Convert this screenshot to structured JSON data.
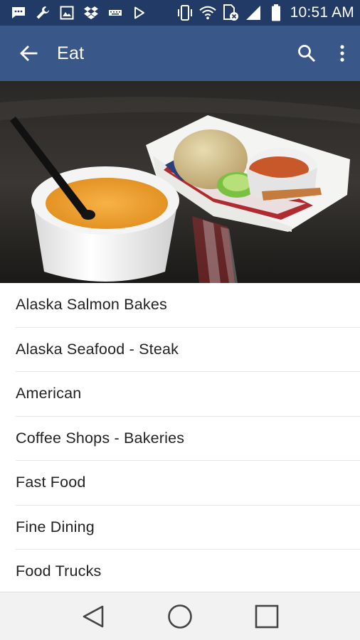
{
  "status_bar": {
    "time": "10:51 AM",
    "icons": [
      "messaging-icon",
      "wrench-icon",
      "image-icon",
      "dropbox-icon",
      "keyboard-icon",
      "play-store-icon",
      "vibrate-icon",
      "wifi-icon",
      "sim-icon",
      "signal-icon",
      "battery-icon"
    ]
  },
  "app_bar": {
    "title": "Eat",
    "back_icon": "arrow-back-icon",
    "search_icon": "search-icon",
    "overflow_icon": "more-vert-icon",
    "color": "#3a5789"
  },
  "hero": {
    "image": "photo of a cup of orange bisque soup with a black spoon next to a paper food boat with a bread roll, lime wedge and sauce cup on an American-flag liner"
  },
  "list": {
    "items": [
      {
        "label": "Alaska Salmon Bakes"
      },
      {
        "label": "Alaska Seafood - Steak"
      },
      {
        "label": "American"
      },
      {
        "label": "Coffee Shops - Bakeries"
      },
      {
        "label": "Fast Food"
      },
      {
        "label": "Fine Dining"
      },
      {
        "label": "Food Trucks"
      }
    ]
  },
  "nav_bar": {
    "icons": [
      "back-triangle-icon",
      "home-circle-icon",
      "recents-square-icon"
    ]
  }
}
